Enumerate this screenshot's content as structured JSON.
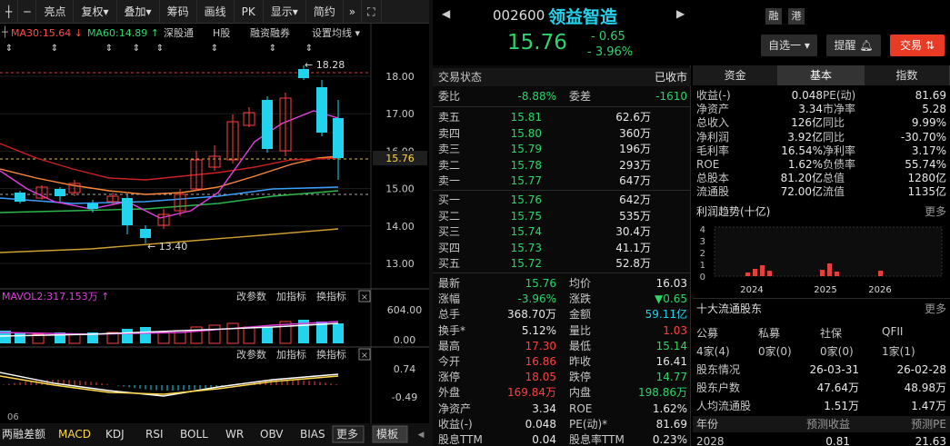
{
  "toolbar": {
    "items": [
      "亮点",
      "复权",
      "叠加",
      "筹码",
      "画线",
      "PK",
      "显示",
      "简约"
    ]
  },
  "ma_legend": {
    "ma30": "MA30:15.64",
    "ma60": "MA60:14.89",
    "sh": "深股通",
    "h": "H股",
    "rz": "融资融券",
    "set": "设置均线"
  },
  "price_axis": [
    "18.00",
    "17.00",
    "16.00",
    "15.00",
    "14.00",
    "13.00"
  ],
  "last_price_tag": "15.76",
  "hi_label": "18.28",
  "lo_label": "13.40",
  "vol_legend": "MAVOL2:317.153万",
  "vol_btns": [
    "改参数",
    "加指标",
    "换指标"
  ],
  "vol_axis": [
    "604.00",
    "0.00"
  ],
  "macd_btns": [
    "改参数",
    "加指标",
    "换指标"
  ],
  "macd_axis": [
    "0.74",
    "-0.49"
  ],
  "bottom_tabs": [
    "两融差额",
    "MACD",
    "KDJ",
    "RSI",
    "BOLL",
    "WR",
    "OBV",
    "BIAS",
    "更多",
    "模板"
  ],
  "date_label": "06",
  "stock": {
    "code": "002600",
    "name": "领益智造",
    "price": "15.76",
    "chg": "- 0.65",
    "pct": "- 3.96%",
    "tags": [
      "融",
      "港"
    ],
    "self": "自选一",
    "remind": "提醒",
    "trade": "交易"
  },
  "status": {
    "label": "交易状态",
    "value": "已收市"
  },
  "weibi": {
    "l1": "委比",
    "v1": "-8.88%",
    "l2": "委差",
    "v2": "-1610"
  },
  "sells": [
    {
      "n": "卖五",
      "p": "15.81",
      "v": "62.6万"
    },
    {
      "n": "卖四",
      "p": "15.80",
      "v": "360万"
    },
    {
      "n": "卖三",
      "p": "15.79",
      "v": "196万"
    },
    {
      "n": "卖二",
      "p": "15.78",
      "v": "293万"
    },
    {
      "n": "卖一",
      "p": "15.77",
      "v": "647万"
    }
  ],
  "buys": [
    {
      "n": "买一",
      "p": "15.76",
      "v": "642万"
    },
    {
      "n": "买二",
      "p": "15.75",
      "v": "535万"
    },
    {
      "n": "买三",
      "p": "15.74",
      "v": "30.4万"
    },
    {
      "n": "买四",
      "p": "15.73",
      "v": "41.1万"
    },
    {
      "n": "买五",
      "p": "15.72",
      "v": "52.8万"
    }
  ],
  "quote": [
    [
      "最新",
      "15.76",
      "均价",
      "16.03"
    ],
    [
      "涨幅",
      "-3.96%",
      "涨跌",
      "▼0.65"
    ],
    [
      "总手",
      "368.70万",
      "金额",
      "59.11亿"
    ],
    [
      "换手*",
      "5.12%",
      "量比",
      "1.03"
    ],
    [
      "最高",
      "17.30",
      "最低",
      "15.14"
    ],
    [
      "今开",
      "16.86",
      "昨收",
      "16.41"
    ],
    [
      "涨停",
      "18.05",
      "跌停",
      "14.77"
    ],
    [
      "外盘",
      "169.84万",
      "内盘",
      "198.86万"
    ],
    [
      "净资产",
      "3.34",
      "ROE",
      "1.62%"
    ],
    [
      "收益(-)",
      "0.048",
      "PE(动)*",
      "81.69"
    ],
    [
      "股息TTM",
      "0.04",
      "股息率TTM",
      "0.23%"
    ]
  ],
  "ftabs": [
    "资金",
    "基本",
    "指数"
  ],
  "fund": [
    [
      "收益(-)",
      "0.048",
      "PE(动)",
      "81.69"
    ],
    [
      "净资产",
      "3.34",
      "市净率",
      "5.28"
    ],
    [
      "总收入",
      "126亿",
      "同比",
      "9.99%"
    ],
    [
      "净利润",
      "3.92亿",
      "同比",
      "-30.70%"
    ],
    [
      "毛利率",
      "16.54%",
      "净利率",
      "3.17%"
    ],
    [
      "ROE",
      "1.62%",
      "负债率",
      "55.74%"
    ],
    [
      "总股本",
      "81.20亿",
      "总值",
      "1280亿"
    ],
    [
      "流通股",
      "72.00亿",
      "流值",
      "1135亿"
    ]
  ],
  "profit": {
    "title": "利润趋势(十亿)",
    "more": "更多",
    "yaxis": [
      "4",
      "3",
      "2",
      "1",
      "0"
    ],
    "years": [
      "2024",
      "2025",
      "2026"
    ]
  },
  "holders": {
    "title": "十大流通股东",
    "more": "更多",
    "cols": [
      "公募",
      "私募",
      "社保",
      "QFII"
    ],
    "vals": [
      "4家(4)",
      "0家(0)",
      "0家(0)",
      "1家(1)"
    ],
    "rows": [
      [
        "股东情况",
        "26-03-31",
        "26-02-28"
      ],
      [
        "股东户数",
        "47.64万",
        "48.98万"
      ],
      [
        "人均流通股",
        "1.51万",
        "1.47万"
      ]
    ]
  },
  "forecast": {
    "h": [
      "年份",
      "预测收益",
      "预测PE"
    ],
    "r": [
      "2028",
      "0.81",
      "21.63"
    ]
  }
}
